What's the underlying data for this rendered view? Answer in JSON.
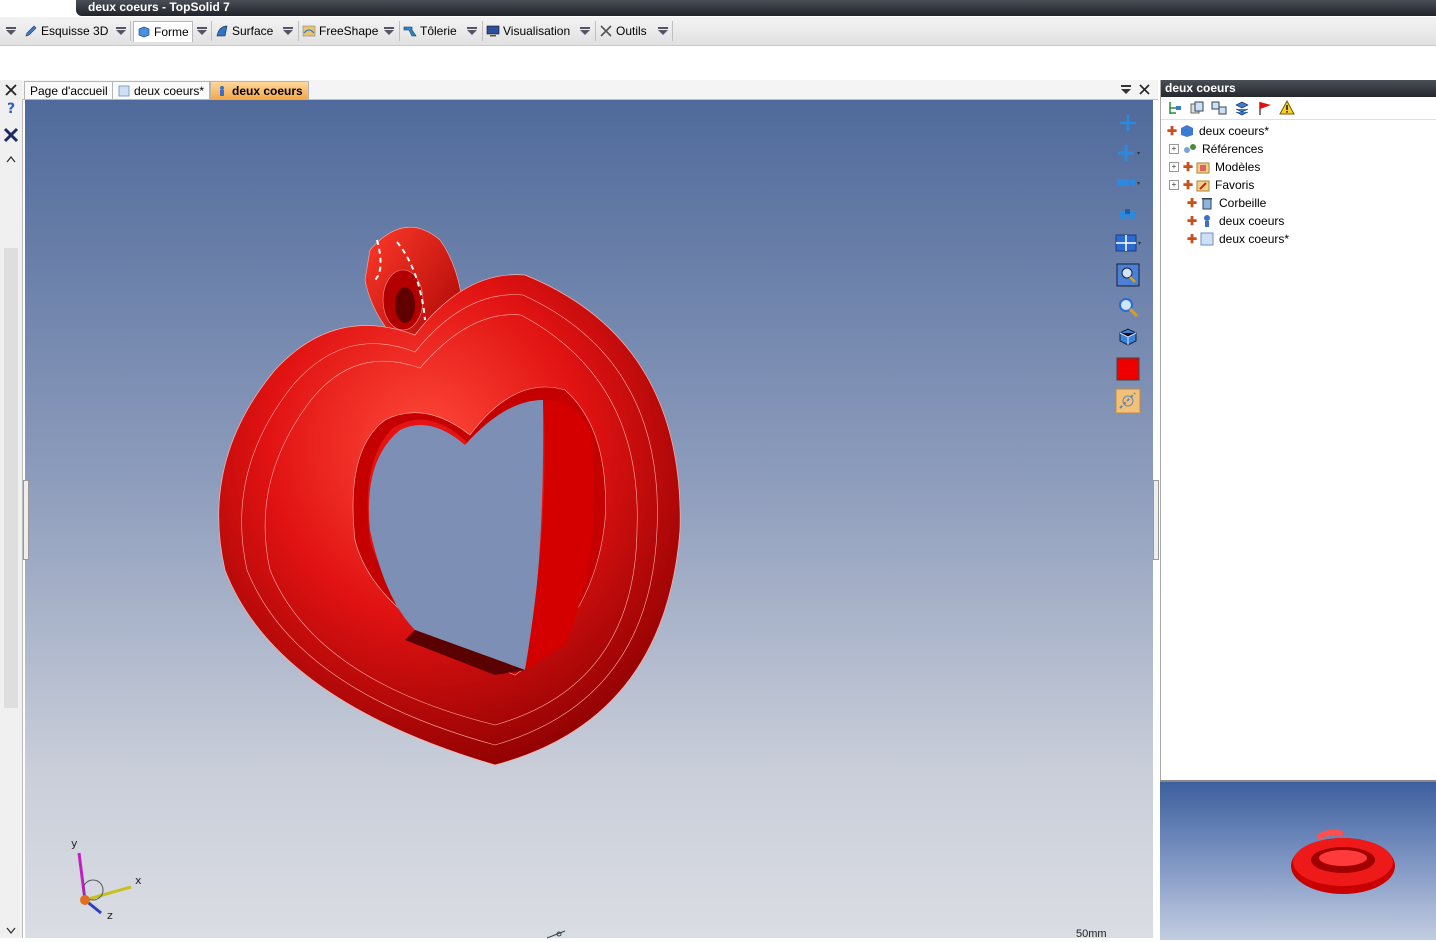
{
  "window": {
    "title": "deux coeurs - TopSolid 7"
  },
  "ribbon": {
    "tabs": [
      {
        "label": "Esquisse 3D",
        "icon": "pencil-icon"
      },
      {
        "label": "Forme",
        "icon": "box-icon"
      },
      {
        "label": "Surface",
        "icon": "surface-icon"
      },
      {
        "label": "FreeShape",
        "icon": "freeshape-icon"
      },
      {
        "label": "Tôlerie",
        "icon": "sheetmetal-icon"
      },
      {
        "label": "Visualisation",
        "icon": "monitor-icon"
      },
      {
        "label": "Outils",
        "icon": "tools-icon"
      }
    ]
  },
  "doc_tabs": [
    {
      "label": "Page d'accueil"
    },
    {
      "label": "deux coeurs*"
    },
    {
      "label": "deux coeurs"
    }
  ],
  "viewport": {
    "axes": {
      "x": "x",
      "y": "y",
      "z": "z"
    },
    "scale_label": "50mm"
  },
  "right_panel": {
    "title": "deux coeurs",
    "tree": [
      {
        "label": "deux coeurs*"
      },
      {
        "label": "Références"
      },
      {
        "label": "Modèles"
      },
      {
        "label": "Favoris"
      },
      {
        "label": "Corbeille"
      },
      {
        "label": "deux coeurs"
      },
      {
        "label": "deux coeurs*"
      }
    ]
  },
  "colors": {
    "accent_tab": "#f5a94a",
    "model_red": "#d81010",
    "title_dark": "#2a2d33"
  }
}
